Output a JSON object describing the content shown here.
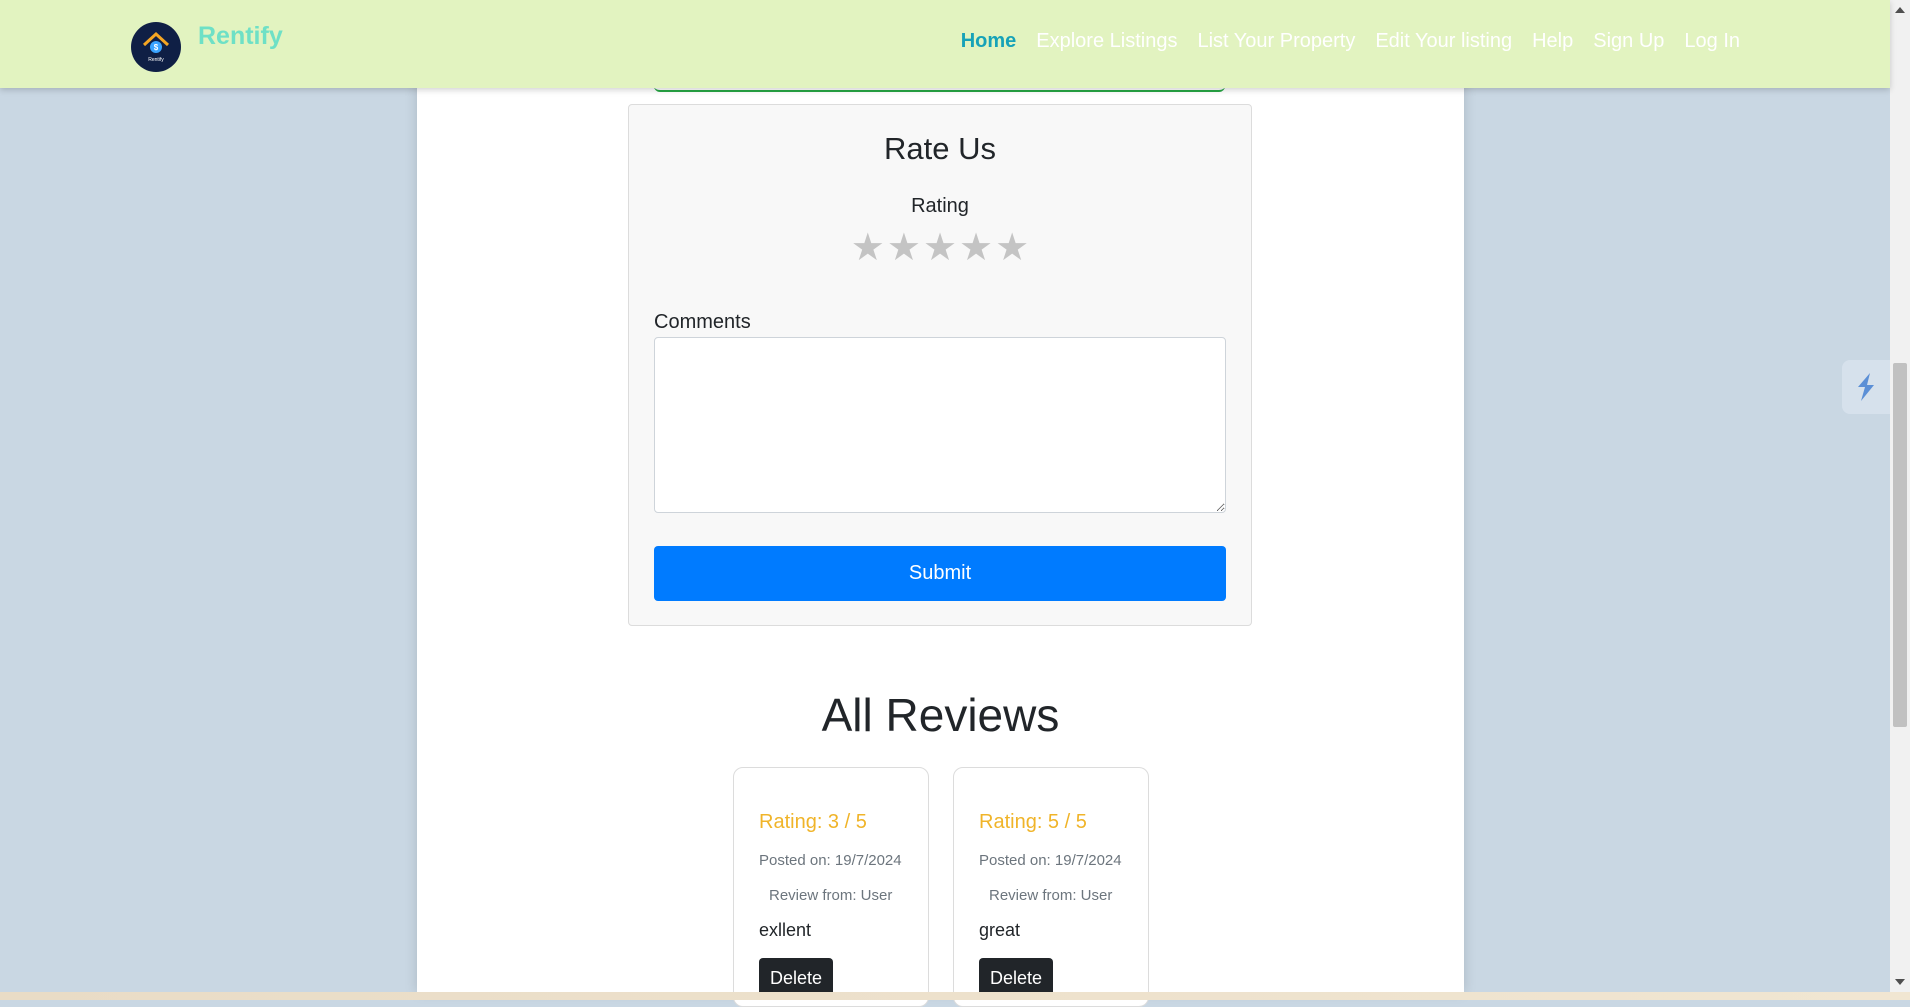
{
  "nav": {
    "brand": "Rentify",
    "logo_text": "Rentify",
    "links": [
      "Home",
      "Explore Listings",
      "List Your Property",
      "Edit Your listing",
      "Help",
      "Sign Up",
      "Log In"
    ]
  },
  "rate_form": {
    "title": "Rate Us",
    "rating_label": "Rating",
    "star_glyph": "★",
    "star_count": 5,
    "selected_rating": 0,
    "comments_label": "Comments",
    "comments_value": "",
    "submit_label": "Submit"
  },
  "reviews": {
    "heading": "All Reviews",
    "items": [
      {
        "rating": "Rating: 3 / 5",
        "posted": "Posted on: 19/7/2024",
        "from": "Review from: User",
        "text": "exllent",
        "delete_label": "Delete"
      },
      {
        "rating": "Rating: 5 / 5",
        "posted": "Posted on: 19/7/2024",
        "from": "Review from: User",
        "text": "great",
        "delete_label": "Delete"
      }
    ]
  },
  "colors": {
    "navbar_bg": "#e2f3c0",
    "brand": "#6ee0c6",
    "active_link": "#17a2b8",
    "submit": "#007bff",
    "rating_text": "#f0b429"
  }
}
